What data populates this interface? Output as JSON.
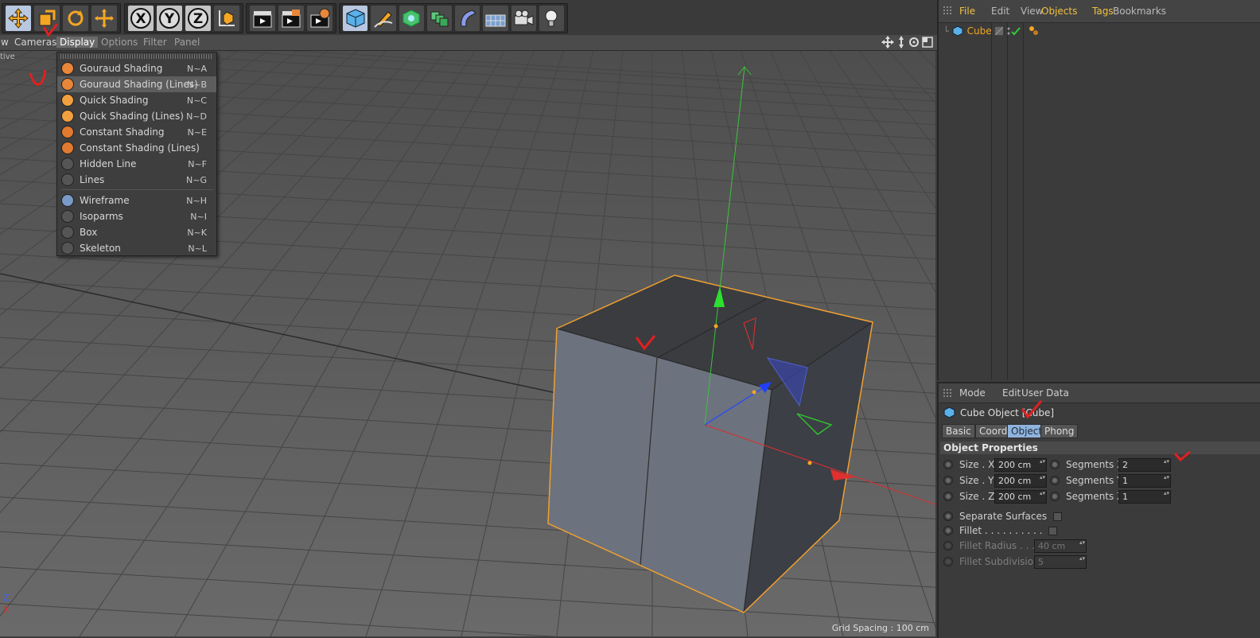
{
  "viewport_menu": {
    "items": [
      {
        "label": "w"
      },
      {
        "label": "Cameras"
      },
      {
        "label": "Display"
      },
      {
        "label": "Options"
      },
      {
        "label": "Filter"
      },
      {
        "label": "Panel"
      }
    ],
    "corner_label": "tive"
  },
  "viewport": {
    "grid_spacing": "Grid Spacing : 100 cm",
    "axis_z": "Z",
    "axis_x": "X"
  },
  "display_menu": {
    "items": [
      {
        "label": "Gouraud Shading",
        "shortcut": "N~A",
        "color": "#e8863a"
      },
      {
        "label": "Gouraud Shading (Lines)",
        "shortcut": "N~B",
        "color": "#e8863a"
      },
      {
        "label": "Quick Shading",
        "shortcut": "N~C",
        "color": "#f0a040"
      },
      {
        "label": "Quick Shading (Lines)",
        "shortcut": "N~D",
        "color": "#f0a040"
      },
      {
        "label": "Constant Shading",
        "shortcut": "N~E",
        "color": "#e07a30"
      },
      {
        "label": "Constant Shading (Lines)",
        "shortcut": "",
        "color": "#e07a30"
      },
      {
        "label": "Hidden Line",
        "shortcut": "N~F",
        "color": "#555555"
      },
      {
        "label": "Lines",
        "shortcut": "N~G",
        "color": "#555555"
      },
      {
        "label": "Wireframe",
        "shortcut": "N~H",
        "color": "#7a9ac8"
      },
      {
        "label": "Isoparms",
        "shortcut": "N~I",
        "color": "#555555"
      },
      {
        "label": "Box",
        "shortcut": "N~K",
        "color": "#555555"
      },
      {
        "label": "Skeleton",
        "shortcut": "N~L",
        "color": "#555555"
      }
    ]
  },
  "objects_panel": {
    "menu": [
      "File",
      "Edit",
      "View",
      "Objects",
      "Tags",
      "Bookmarks"
    ],
    "object_name": "Cube"
  },
  "attributes_panel": {
    "menu": [
      "Mode",
      "Edit",
      "User Data"
    ],
    "title": "Cube Object [Cube]",
    "tabs": [
      "Basic",
      "Coord.",
      "Object",
      "Phong"
    ],
    "active_tab": "Object",
    "section": "Object Properties",
    "size_x_label": "Size . X",
    "size_x": "200 cm",
    "size_y_label": "Size . Y",
    "size_y": "200 cm",
    "size_z_label": "Size . Z",
    "size_z": "200 cm",
    "seg_x_label": "Segments X",
    "seg_x": "2",
    "seg_y_label": "Segments Y",
    "seg_y": "1",
    "seg_z_label": "Segments Z",
    "seg_z": "1",
    "separate_surfaces": "Separate Surfaces",
    "fillet": "Fillet . . . . . . . . . .",
    "fillet_radius_label": "Fillet Radius . . . .",
    "fillet_radius": "40 cm",
    "fillet_subdiv_label": "Fillet Subdivision",
    "fillet_subdiv": "5"
  },
  "colors": {
    "accent": "#f0a030",
    "selected_tab": "#8fb3dd",
    "object_highlight": "#f5a623"
  }
}
